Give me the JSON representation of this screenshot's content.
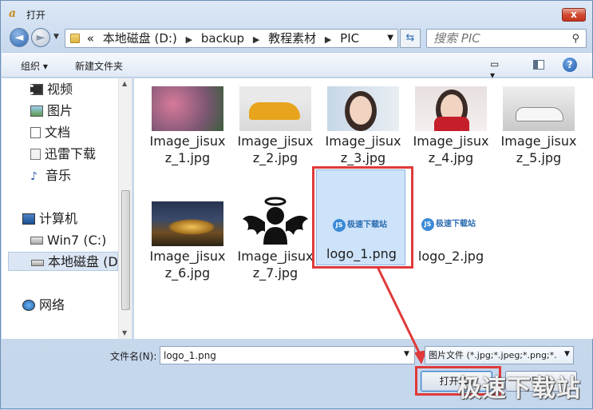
{
  "window": {
    "title": "打开",
    "close_label": "x"
  },
  "nav": {
    "back_glyph": "◄",
    "forward_glyph": "►",
    "address": {
      "prefix": "«",
      "segments": [
        "本地磁盘 (D:)",
        "backup",
        "教程素材",
        "PIC"
      ]
    },
    "search_placeholder": "搜索 PIC"
  },
  "toolbar": {
    "organize_label": "组织 ▾",
    "new_folder_label": "新建文件夹",
    "help_label": "?"
  },
  "sidebar": {
    "items": [
      {
        "label": "视频",
        "icon": "video-icon"
      },
      {
        "label": "图片",
        "icon": "picture-icon"
      },
      {
        "label": "文档",
        "icon": "document-icon"
      },
      {
        "label": "迅雷下载",
        "icon": "download-icon"
      },
      {
        "label": "音乐",
        "icon": "music-icon"
      },
      {
        "label": "计算机",
        "icon": "computer-icon"
      },
      {
        "label": "Win7 (C:)",
        "icon": "drive-icon"
      },
      {
        "label": "本地磁盘 (D:",
        "icon": "drive-icon"
      },
      {
        "label": "网络",
        "icon": "network-icon"
      }
    ]
  },
  "files": [
    {
      "name": "Image_jisuxz_1.jpg",
      "line1": "Image_jisux",
      "line2": "z_1.jpg"
    },
    {
      "name": "Image_jisuxz_2.jpg",
      "line1": "Image_jisux",
      "line2": "z_2.jpg"
    },
    {
      "name": "Image_jisuxz_3.jpg",
      "line1": "Image_jisux",
      "line2": "z_3.jpg"
    },
    {
      "name": "Image_jisuxz_4.jpg",
      "line1": "Image_jisux",
      "line2": "z_4.jpg"
    },
    {
      "name": "Image_jisuxz_5.jpg",
      "line1": "Image_jisux",
      "line2": "z_5.jpg"
    },
    {
      "name": "Image_jisuxz_6.jpg",
      "line1": "Image_jisux",
      "line2": "z_6.jpg"
    },
    {
      "name": "Image_jisuxz_7.jpg",
      "line1": "Image_jisux",
      "line2": "z_7.jpg"
    },
    {
      "name": "logo_1.png",
      "line1": "logo_1.png",
      "line2": "",
      "selected": true,
      "logo_text": "极速下载站"
    },
    {
      "name": "logo_2.jpg",
      "line1": "logo_2.jpg",
      "line2": "",
      "logo_text": "极速下载站"
    }
  ],
  "bottom": {
    "filename_label": "文件名(N):",
    "filename_value": "logo_1.png",
    "filetype_value": "图片文件 (*.jpg;*.jpeg;*.png;*.",
    "open_label": "打开(O)",
    "cancel_label": "取消"
  },
  "watermark": "极速下载站",
  "colors": {
    "highlight_box": "#e03a3a",
    "selection": "#cde3fa"
  }
}
